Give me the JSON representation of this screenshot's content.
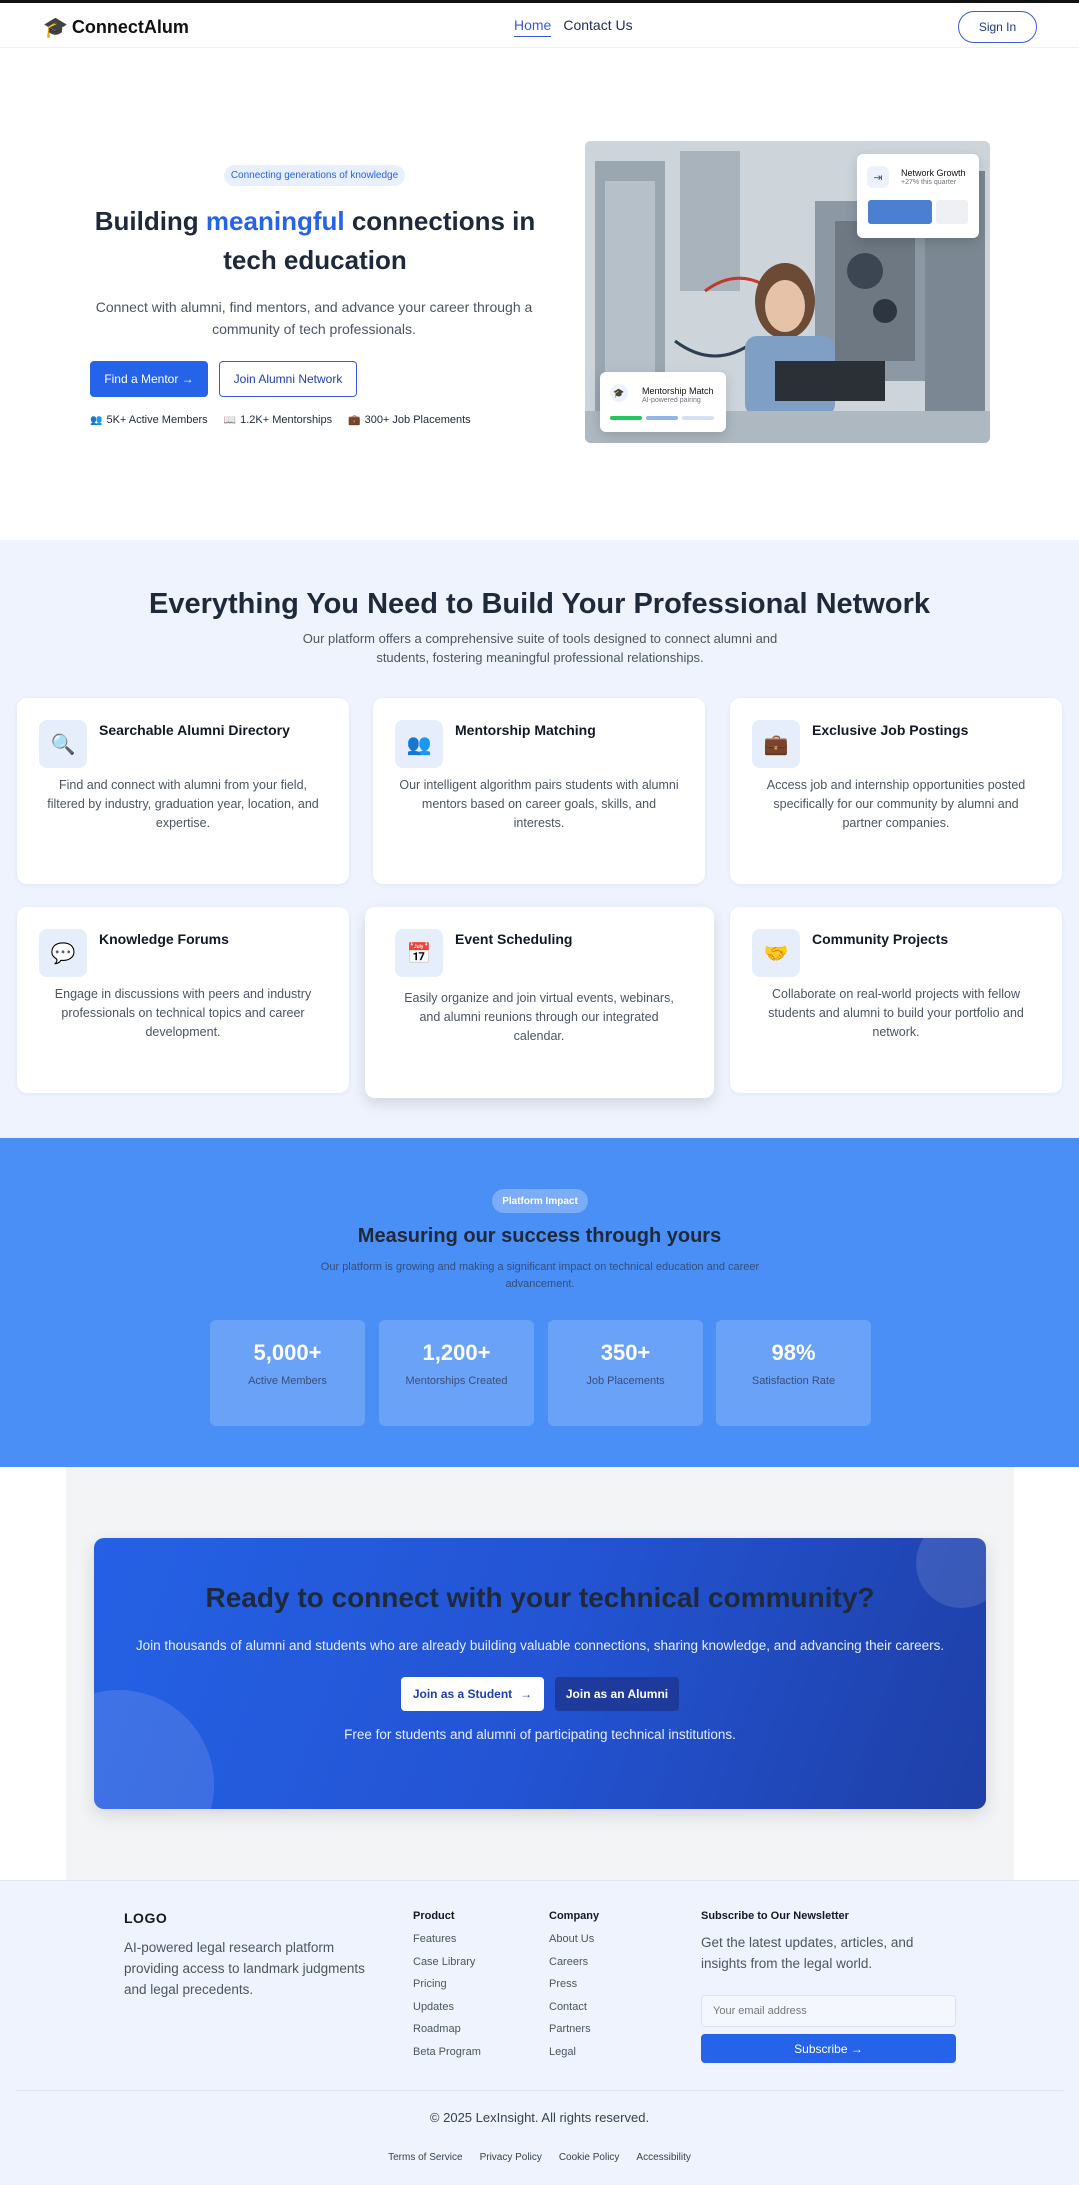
{
  "nav": {
    "logo": "ConnectAlum",
    "links": [
      "Home",
      "Contact Us"
    ],
    "signin": "Sign In"
  },
  "hero": {
    "pill": "Connecting generations of knowledge",
    "title_before": "Building ",
    "title_highlight": "meaningful",
    "title_after": " connections in tech education",
    "subtitle": "Connect with alumni, find mentors, and advance your career through a community of tech professionals.",
    "cta_primary": "Find a Mentor →",
    "cta_secondary": "Join Alumni Network",
    "stats": [
      "5K+ Active Members",
      "1.2K+ Mentorships",
      "300+ Job Placements"
    ],
    "growth_card": {
      "title": "Network Growth",
      "sub": "+27% this quarter"
    },
    "match_card": {
      "title": "Mentorship Match",
      "sub": "AI-powered pairing"
    }
  },
  "features": {
    "title": "Everything You Need to Build Your Professional Network",
    "subtitle": "Our platform offers a comprehensive suite of tools designed to connect alumni and students, fostering meaningful professional relationships.",
    "cards": [
      {
        "icon": "🔍",
        "title": "Searchable Alumni Directory",
        "desc": "Find and connect with alumni from your field, filtered by industry, graduation year, location, and expertise."
      },
      {
        "icon": "👥",
        "title": "Mentorship Matching",
        "desc": "Our intelligent algorithm pairs students with alumni mentors based on career goals, skills, and interests."
      },
      {
        "icon": "💼",
        "title": "Exclusive Job Postings",
        "desc": "Access job and internship opportunities posted specifically for our community by alumni and partner companies."
      },
      {
        "icon": "💬",
        "title": "Knowledge Forums",
        "desc": "Engage in discussions with peers and industry professionals on technical topics and career development."
      },
      {
        "icon": "📅",
        "title": "Event Scheduling",
        "desc": "Easily organize and join virtual events, webinars, and alumni reunions through our integrated calendar."
      },
      {
        "icon": "🤝",
        "title": "Community Projects",
        "desc": "Collaborate on real-world projects with fellow students and alumni to build your portfolio and network."
      }
    ]
  },
  "impact": {
    "pill": "Platform Impact",
    "title": "Measuring our success through yours",
    "subtitle": "Our platform is growing and making a significant impact on technical education and career advancement.",
    "stats": [
      {
        "value": "5,000+",
        "label": "Active Members"
      },
      {
        "value": "1,200+",
        "label": "Mentorships Created"
      },
      {
        "value": "350+",
        "label": "Job Placements"
      },
      {
        "value": "98%",
        "label": "Satisfaction Rate"
      }
    ]
  },
  "cta": {
    "title": "Ready to connect with your technical community?",
    "subtitle": "Join thousands of alumni and students who are already building valuable connections, sharing knowledge, and advancing their careers.",
    "btn_student": "Join as a Student",
    "btn_alumni": "Join as an Alumni",
    "note": "Free for students and alumni of participating technical institutions."
  },
  "footer": {
    "logo": "LOGO",
    "desc": "AI-powered legal research platform providing access to landmark judgments and legal precedents.",
    "product": {
      "title": "Product",
      "links": [
        "Features",
        "Case Library",
        "Pricing",
        "Updates",
        "Roadmap",
        "Beta Program"
      ]
    },
    "company": {
      "title": "Company",
      "links": [
        "About Us",
        "Careers",
        "Press",
        "Contact",
        "Partners",
        "Legal"
      ]
    },
    "newsletter": {
      "title": "Subscribe to Our Newsletter",
      "desc": "Get the latest updates, articles, and insights from the legal world.",
      "placeholder": "Your email address",
      "button": "Subscribe →"
    },
    "copyright": "© 2025 LexInsight. All rights reserved.",
    "legal": [
      "Terms of Service",
      "Privacy Policy",
      "Cookie Policy",
      "Accessibility"
    ]
  }
}
